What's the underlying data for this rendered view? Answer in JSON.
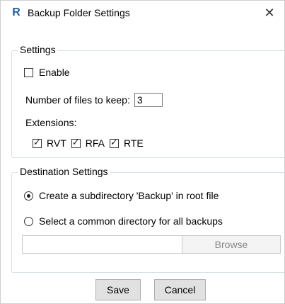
{
  "window": {
    "icon_glyph": "R",
    "title": "Backup Folder Settings",
    "close_glyph": "✕"
  },
  "settings": {
    "group_label": "Settings",
    "enable_label": "Enable",
    "enable_checked": false,
    "files_to_keep_label": "Number of files to keep:",
    "files_to_keep_value": "3",
    "extensions_label": "Extensions:",
    "extensions": [
      {
        "label": "RVT",
        "checked": true
      },
      {
        "label": "RFA",
        "checked": true
      },
      {
        "label": "RTE",
        "checked": true
      }
    ]
  },
  "destination": {
    "group_label": "Destination Settings",
    "option_subdirectory": "Create a subdirectory 'Backup' in root file",
    "option_common": "Select a common directory for all backups",
    "selected": "subdirectory",
    "path_value": "",
    "browse_label": "Browse"
  },
  "footer": {
    "save_label": "Save",
    "cancel_label": "Cancel"
  }
}
